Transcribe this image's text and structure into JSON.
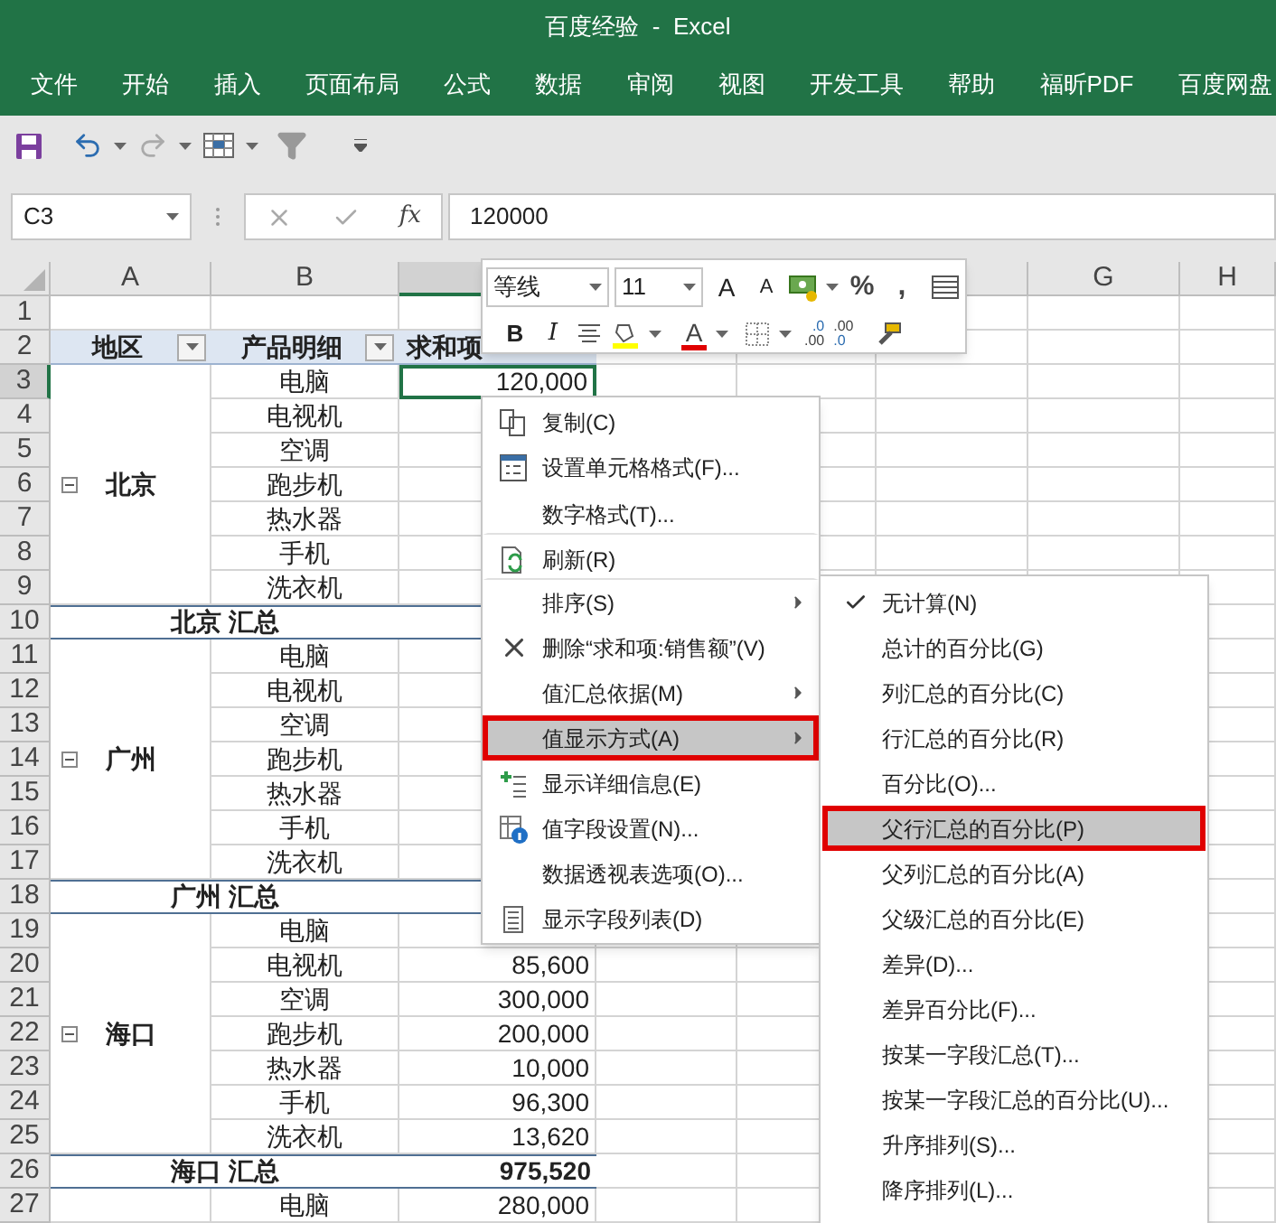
{
  "window": {
    "title": "百度经验  -  Excel"
  },
  "menu_tabs": [
    "文件",
    "开始",
    "插入",
    "页面布局",
    "公式",
    "数据",
    "审阅",
    "视图",
    "开发工具",
    "帮助",
    "福昕PDF",
    "百度网盘"
  ],
  "name_box": {
    "value": "C3"
  },
  "formula_bar": {
    "fx": "fx",
    "value": "120000"
  },
  "columns": [
    {
      "label": "A",
      "selected": false
    },
    {
      "label": "B",
      "selected": false
    },
    {
      "selected": true
    },
    {
      "label": "G",
      "selected": false
    },
    {
      "label": "H",
      "selected": false
    }
  ],
  "row_headers": [
    {
      "label": "1",
      "selected": false
    },
    {
      "label": "2",
      "selected": false
    },
    {
      "label": "3",
      "selected": true
    },
    {
      "label": "4",
      "selected": false
    },
    {
      "label": "5",
      "selected": false
    },
    {
      "label": "6",
      "selected": false
    },
    {
      "label": "7",
      "selected": false
    },
    {
      "label": "8",
      "selected": false
    },
    {
      "label": "9",
      "selected": false
    },
    {
      "label": "10",
      "selected": false
    },
    {
      "label": "11",
      "selected": false
    },
    {
      "label": "12",
      "selected": false
    },
    {
      "label": "13",
      "selected": false
    },
    {
      "label": "14",
      "selected": false
    },
    {
      "label": "15",
      "selected": false
    },
    {
      "label": "16",
      "selected": false
    },
    {
      "label": "17",
      "selected": false
    },
    {
      "label": "18",
      "selected": false
    },
    {
      "label": "19",
      "selected": false
    },
    {
      "label": "20",
      "selected": false
    },
    {
      "label": "21",
      "selected": false
    },
    {
      "label": "22",
      "selected": false
    },
    {
      "label": "23",
      "selected": false
    },
    {
      "label": "24",
      "selected": false
    },
    {
      "label": "25",
      "selected": false
    },
    {
      "label": "26",
      "selected": false
    },
    {
      "label": "27",
      "selected": false
    }
  ],
  "pivot": {
    "headers": [
      {
        "label": "地区",
        "filter": true
      },
      {
        "label": "产品明细",
        "filter": true
      },
      {
        "label": "求和项",
        "filter": false
      }
    ],
    "groups": [
      {
        "region": "北京",
        "expanded": true,
        "items": [
          {
            "product": "电脑",
            "value": "120,000",
            "active": true
          },
          {
            "product": "电视机",
            "active": false
          },
          {
            "product": "空调",
            "active": false
          },
          {
            "product": "跑步机",
            "active": false
          },
          {
            "product": "热水器",
            "active": false
          },
          {
            "product": "手机",
            "active": false
          },
          {
            "product": "洗衣机",
            "active": false
          }
        ],
        "total_label": "北京 汇总"
      },
      {
        "region": "广州",
        "expanded": true,
        "items": [
          {
            "product": "电脑",
            "active": false
          },
          {
            "product": "电视机",
            "active": false
          },
          {
            "product": "空调",
            "active": false
          },
          {
            "product": "跑步机",
            "active": false
          },
          {
            "product": "热水器",
            "active": false
          },
          {
            "product": "手机",
            "active": false
          },
          {
            "product": "洗衣机",
            "active": false
          }
        ],
        "total_label": "广州 汇总"
      },
      {
        "region": "海口",
        "expanded": true,
        "items": [
          {
            "product": "电脑",
            "active": false
          },
          {
            "product": "电视机",
            "value": "85,600",
            "active": false
          },
          {
            "product": "空调",
            "value": "300,000",
            "active": false
          },
          {
            "product": "跑步机",
            "value": "200,000",
            "active": false
          },
          {
            "product": "热水器",
            "value": "10,000",
            "active": false
          },
          {
            "product": "手机",
            "value": "96,300",
            "active": false
          },
          {
            "product": "洗衣机",
            "value": "13,620",
            "active": false
          }
        ],
        "total_label": "海口 汇总",
        "total_value": "975,520"
      },
      {
        "items": [
          {
            "product": "电脑",
            "value": "280,000",
            "active": false
          }
        ]
      }
    ]
  },
  "mini_toolbar": {
    "font": "等线",
    "size": "11",
    "grow": "A",
    "shrink": "A",
    "percent": "%",
    "comma": ",",
    "bold": "B",
    "italic": "I",
    "font_color_label": "A",
    "increase_decimal": {
      "top": ".0",
      "bottom": ".00"
    },
    "decrease_decimal": {
      "top": ".00",
      "bottom": ".0"
    }
  },
  "context_menu": [
    {
      "label": "复制(C)",
      "submenu": false,
      "selected": false,
      "separator_after": false
    },
    {
      "label": "设置单元格格式(F)...",
      "submenu": false,
      "selected": false,
      "separator_after": false
    },
    {
      "label": "数字格式(T)...",
      "submenu": false,
      "selected": false,
      "separator_after": true
    },
    {
      "label": "刷新(R)",
      "submenu": false,
      "selected": false,
      "separator_after": true
    },
    {
      "label": "排序(S)",
      "submenu": true,
      "selected": false,
      "separator_after": false
    },
    {
      "label": "删除“求和项:销售额”(V)",
      "submenu": false,
      "selected": false,
      "separator_after": false
    },
    {
      "label": "值汇总依据(M)",
      "submenu": true,
      "selected": false,
      "separator_after": false
    },
    {
      "label": "值显示方式(A)",
      "submenu": true,
      "selected": true,
      "separator_after": false
    },
    {
      "label": "显示详细信息(E)",
      "submenu": false,
      "selected": false,
      "separator_after": false
    },
    {
      "label": "值字段设置(N)...",
      "submenu": false,
      "selected": false,
      "separator_after": false
    },
    {
      "label": "数据透视表选项(O)...",
      "submenu": false,
      "selected": false,
      "separator_after": false
    },
    {
      "label": "显示字段列表(D)",
      "submenu": false,
      "selected": false,
      "separator_after": false
    }
  ],
  "submenu": [
    {
      "label": "无计算(N)",
      "checked": true,
      "selected": false
    },
    {
      "label": "总计的百分比(G)",
      "checked": false,
      "selected": false
    },
    {
      "label": "列汇总的百分比(C)",
      "checked": false,
      "selected": false
    },
    {
      "label": "行汇总的百分比(R)",
      "checked": false,
      "selected": false
    },
    {
      "label": "百分比(O)...",
      "checked": false,
      "selected": false
    },
    {
      "label": "父行汇总的百分比(P)",
      "checked": false,
      "selected": true
    },
    {
      "label": "父列汇总的百分比(A)",
      "checked": false,
      "selected": false
    },
    {
      "label": "父级汇总的百分比(E)",
      "checked": false,
      "selected": false
    },
    {
      "label": "差异(D)...",
      "checked": false,
      "selected": false
    },
    {
      "label": "差异百分比(F)...",
      "checked": false,
      "selected": false
    },
    {
      "label": "按某一字段汇总(T)...",
      "checked": false,
      "selected": false
    },
    {
      "label": "按某一字段汇总的百分比(U)...",
      "checked": false,
      "selected": false
    },
    {
      "label": "升序排列(S)...",
      "checked": false,
      "selected": false
    },
    {
      "label": "降序排列(L)...",
      "checked": false,
      "selected": false
    }
  ]
}
